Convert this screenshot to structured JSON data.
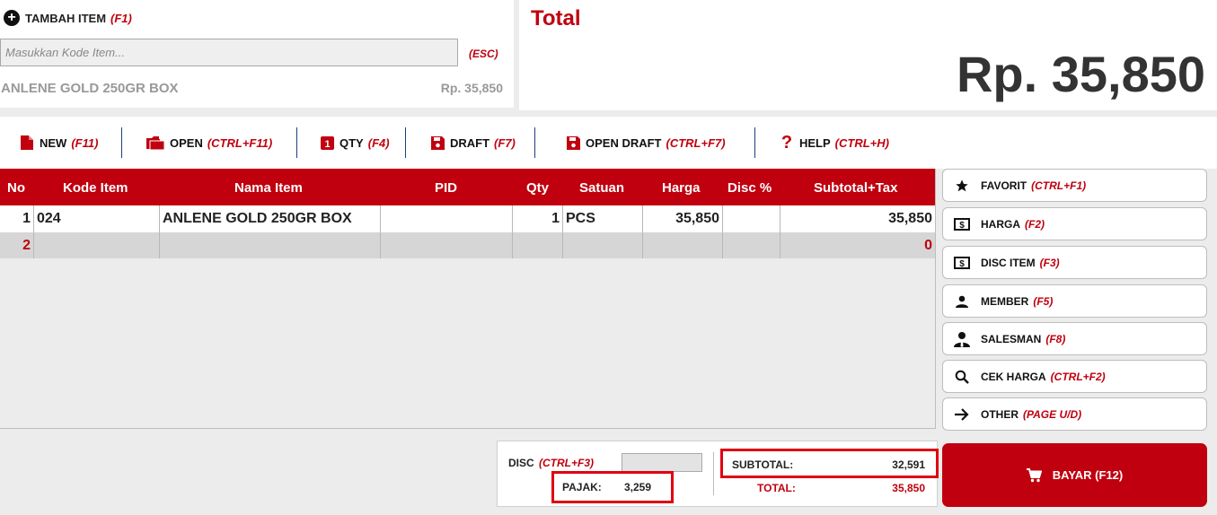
{
  "add_item": {
    "title": "TAMBAH ITEM",
    "shortcut": "(F1)",
    "placeholder": "Masukkan Kode Item...",
    "esc": "(ESC)",
    "last_item_name": "ANLENE GOLD 250GR BOX",
    "last_item_price": "Rp. 35,850"
  },
  "total": {
    "label": "Total",
    "value": "Rp. 35,850"
  },
  "toolbar": [
    {
      "label": "NEW",
      "shortcut": "(F11)",
      "icon": "file-icon"
    },
    {
      "label": "OPEN",
      "shortcut": "(CTRL+F11)",
      "icon": "folder-icon"
    },
    {
      "label": "QTY",
      "shortcut": "(F4)",
      "icon": "qty-icon"
    },
    {
      "label": "DRAFT",
      "shortcut": "(F7)",
      "icon": "floppy-icon"
    },
    {
      "label": "OPEN DRAFT",
      "shortcut": "(CTRL+F7)",
      "icon": "floppy-icon"
    },
    {
      "label": "HELP",
      "shortcut": "(CTRL+H)",
      "icon": "question-icon"
    }
  ],
  "table": {
    "headers": [
      "No",
      "Kode Item",
      "Nama Item",
      "PID",
      "Qty",
      "Satuan",
      "Harga",
      "Disc %",
      "Subtotal+Tax"
    ],
    "rows": [
      {
        "no": "1",
        "kode": "024",
        "nama": "ANLENE GOLD 250GR BOX",
        "pid": "",
        "qty": "1",
        "satuan": "PCS",
        "harga": "35,850",
        "disc": "",
        "subtotal": "35,850"
      },
      {
        "no": "2",
        "kode": "",
        "nama": "",
        "pid": "",
        "qty": "",
        "satuan": "",
        "harga": "",
        "disc": "",
        "subtotal": "0"
      }
    ]
  },
  "side_buttons": [
    {
      "label": "FAVORIT",
      "shortcut": "(CTRL+F1)",
      "icon": "star-icon"
    },
    {
      "label": "HARGA",
      "shortcut": "(F2)",
      "icon": "dollar-icon"
    },
    {
      "label": "DISC ITEM",
      "shortcut": "(F3)",
      "icon": "dollar-icon"
    },
    {
      "label": "MEMBER",
      "shortcut": "(F5)",
      "icon": "user-icon"
    },
    {
      "label": "SALESMAN",
      "shortcut": "(F8)",
      "icon": "salesman-icon"
    },
    {
      "label": "CEK HARGA",
      "shortcut": "(CTRL+F2)",
      "icon": "search-icon"
    },
    {
      "label": "OTHER",
      "shortcut": "(PAGE U/D)",
      "icon": "arrow-right-icon"
    }
  ],
  "summary": {
    "disc_label": "DISC",
    "disc_shortcut": "(CTRL+F3)",
    "pajak_label": "PAJAK:",
    "pajak_value": "3,259",
    "subtotal_label": "SUBTOTAL:",
    "subtotal_value": "32,591",
    "total_label": "TOTAL:",
    "total_value": "35,850"
  },
  "pay": {
    "label": "BAYAR (F12)",
    "icon": "cart-icon"
  },
  "colors": {
    "accent": "#c0000e",
    "highlight": "#e00010"
  }
}
